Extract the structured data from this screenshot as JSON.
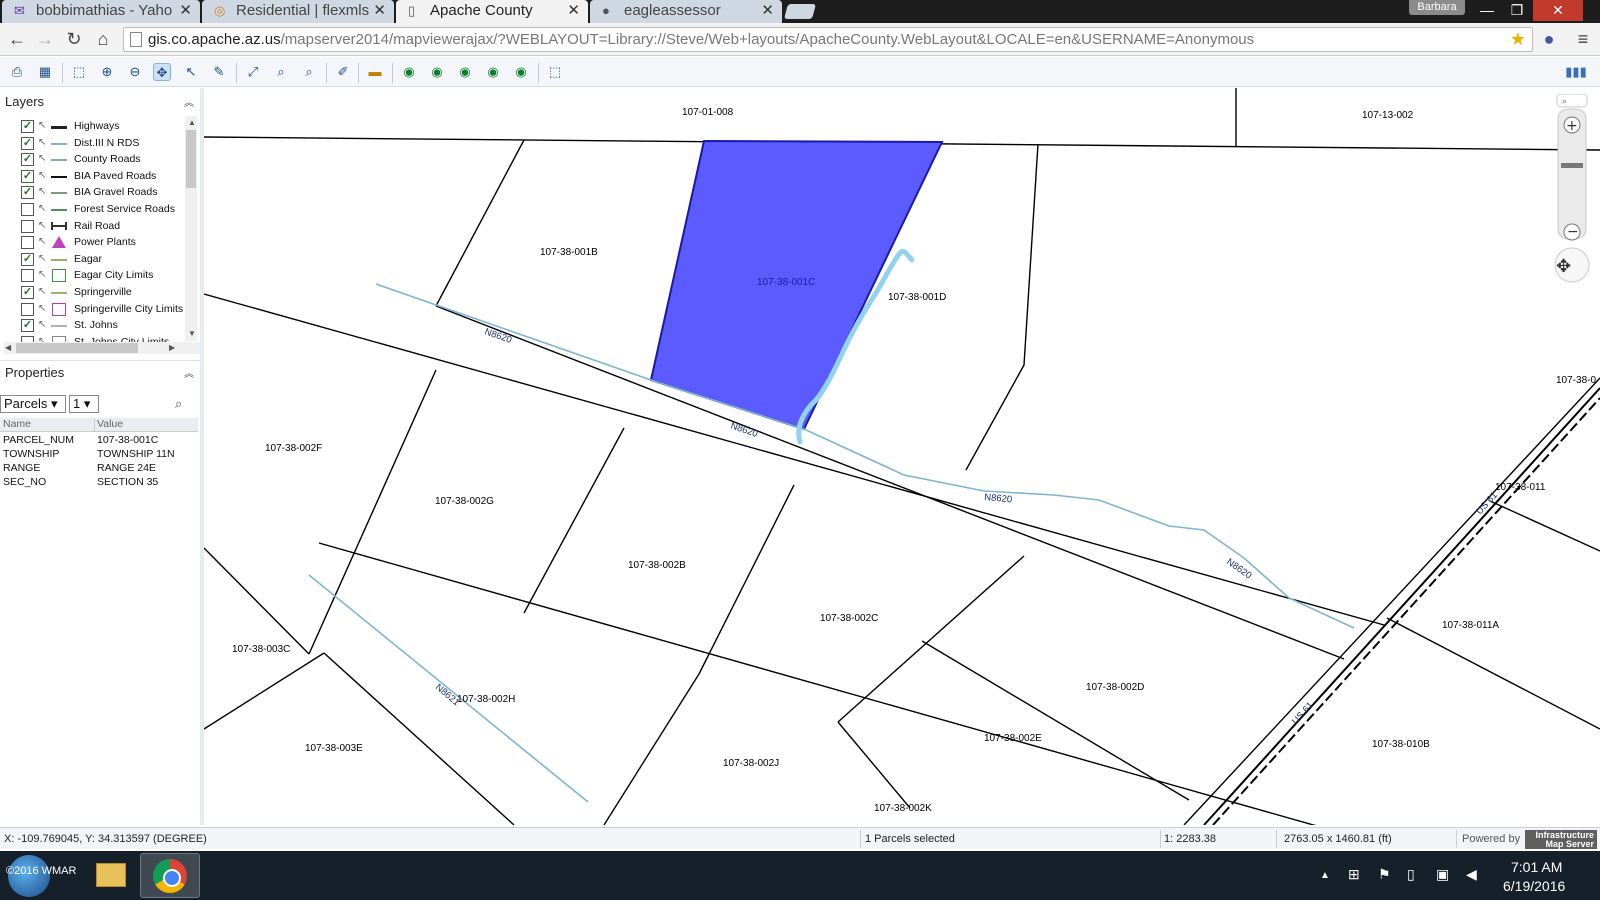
{
  "browser": {
    "tabs": [
      {
        "title": "bobbimathias - Yaho",
        "icon": "mail-icon"
      },
      {
        "title": "Residential | flexmls",
        "icon": "flexmls-icon"
      },
      {
        "title": "Apache County",
        "icon": "page-icon"
      },
      {
        "title": "eagleassessor",
        "icon": "globe-icon"
      }
    ],
    "user": "Barbara",
    "url_host": "gis.co.apache.az.us",
    "url_path": "/mapserver2014/mapviewerajax/?WEBLAYOUT=Library://Steve/Web+layouts/ApacheCounty.WebLayout&LOCALE=en&USERNAME=Anonymous"
  },
  "layers_panel": {
    "title": "Layers",
    "items": [
      {
        "label": "Highways",
        "checked": true,
        "symbol": "thick-line",
        "color": "#222222"
      },
      {
        "label": "Dist.III N RDS",
        "checked": true,
        "symbol": "line",
        "color": "#7db4d8"
      },
      {
        "label": "County Roads",
        "checked": true,
        "symbol": "line",
        "color": "#8fa3c0"
      },
      {
        "label": "BIA Paved Roads",
        "checked": true,
        "symbol": "line",
        "color": "#111111"
      },
      {
        "label": "BIA Gravel Roads",
        "checked": true,
        "symbol": "line",
        "color": "#7a9a7a"
      },
      {
        "label": "Forest Service Roads",
        "checked": false,
        "symbol": "line",
        "color": "#5a8a5a"
      },
      {
        "label": "Rail Road",
        "checked": false,
        "symbol": "rail",
        "color": "#333333"
      },
      {
        "label": "Power Plants",
        "checked": false,
        "symbol": "triangle",
        "color": "#c040c0"
      },
      {
        "label": "Eagar",
        "checked": true,
        "symbol": "line",
        "color": "#9ab070"
      },
      {
        "label": "Eagar City Limits",
        "checked": false,
        "symbol": "box",
        "color": "#3a9a3a"
      },
      {
        "label": "Springerville",
        "checked": true,
        "symbol": "line",
        "color": "#9ab070"
      },
      {
        "label": "Springerville City Limits",
        "checked": false,
        "symbol": "box",
        "color": "#b040b0"
      },
      {
        "label": "St. Johns",
        "checked": true,
        "symbol": "line",
        "color": "#b0b0b0"
      },
      {
        "label": "St. Johns City Limits",
        "checked": false,
        "symbol": "box",
        "color": "#888888"
      }
    ]
  },
  "properties_panel": {
    "title": "Properties",
    "layer_select": "Parcels",
    "index_select": "1",
    "columns": [
      "Name",
      "Value"
    ],
    "rows": [
      {
        "name": "PARCEL_NUM",
        "value": "107-38-001C"
      },
      {
        "name": "TOWNSHIP",
        "value": "TOWNSHIP 11N"
      },
      {
        "name": "RANGE",
        "value": "RANGE 24E"
      },
      {
        "name": "SEC_NO",
        "value": "SECTION 35"
      }
    ]
  },
  "map": {
    "selected_color": "#5b5bff",
    "road_color": "#7db4d8",
    "parcel_labels": [
      "107-01-008",
      "107-13-002",
      "107-38-001B",
      "107-38-001C",
      "107-38-001D",
      "107-38-002F",
      "107-38-002G",
      "107-38-002B",
      "107-38-002C",
      "107-38-002D",
      "107-38-003C",
      "107-38-002H",
      "107-38-003E",
      "107-38-002J",
      "107-38-002E",
      "107-38-002K",
      "107-38-011A",
      "107-38-011",
      "107-38-0",
      "107-38-010B"
    ],
    "road_labels": [
      "N8620",
      "N8620",
      "N8620",
      "N8620",
      "N8621",
      "US 61",
      "US 61"
    ]
  },
  "status_bar": {
    "coords": "X: -109.769045, Y: 34.313597 (DEGREE)",
    "selection": "1 Parcels selected",
    "scale": "1: 2283.38",
    "extent": "2763.05 x 1460.81 (ft)",
    "powered_by": "Powered by",
    "logo_text": "Infrastructure Map Server"
  },
  "taskbar": {
    "copyright": "©2016 WMAR",
    "time": "7:01 AM",
    "date": "6/19/2016"
  }
}
